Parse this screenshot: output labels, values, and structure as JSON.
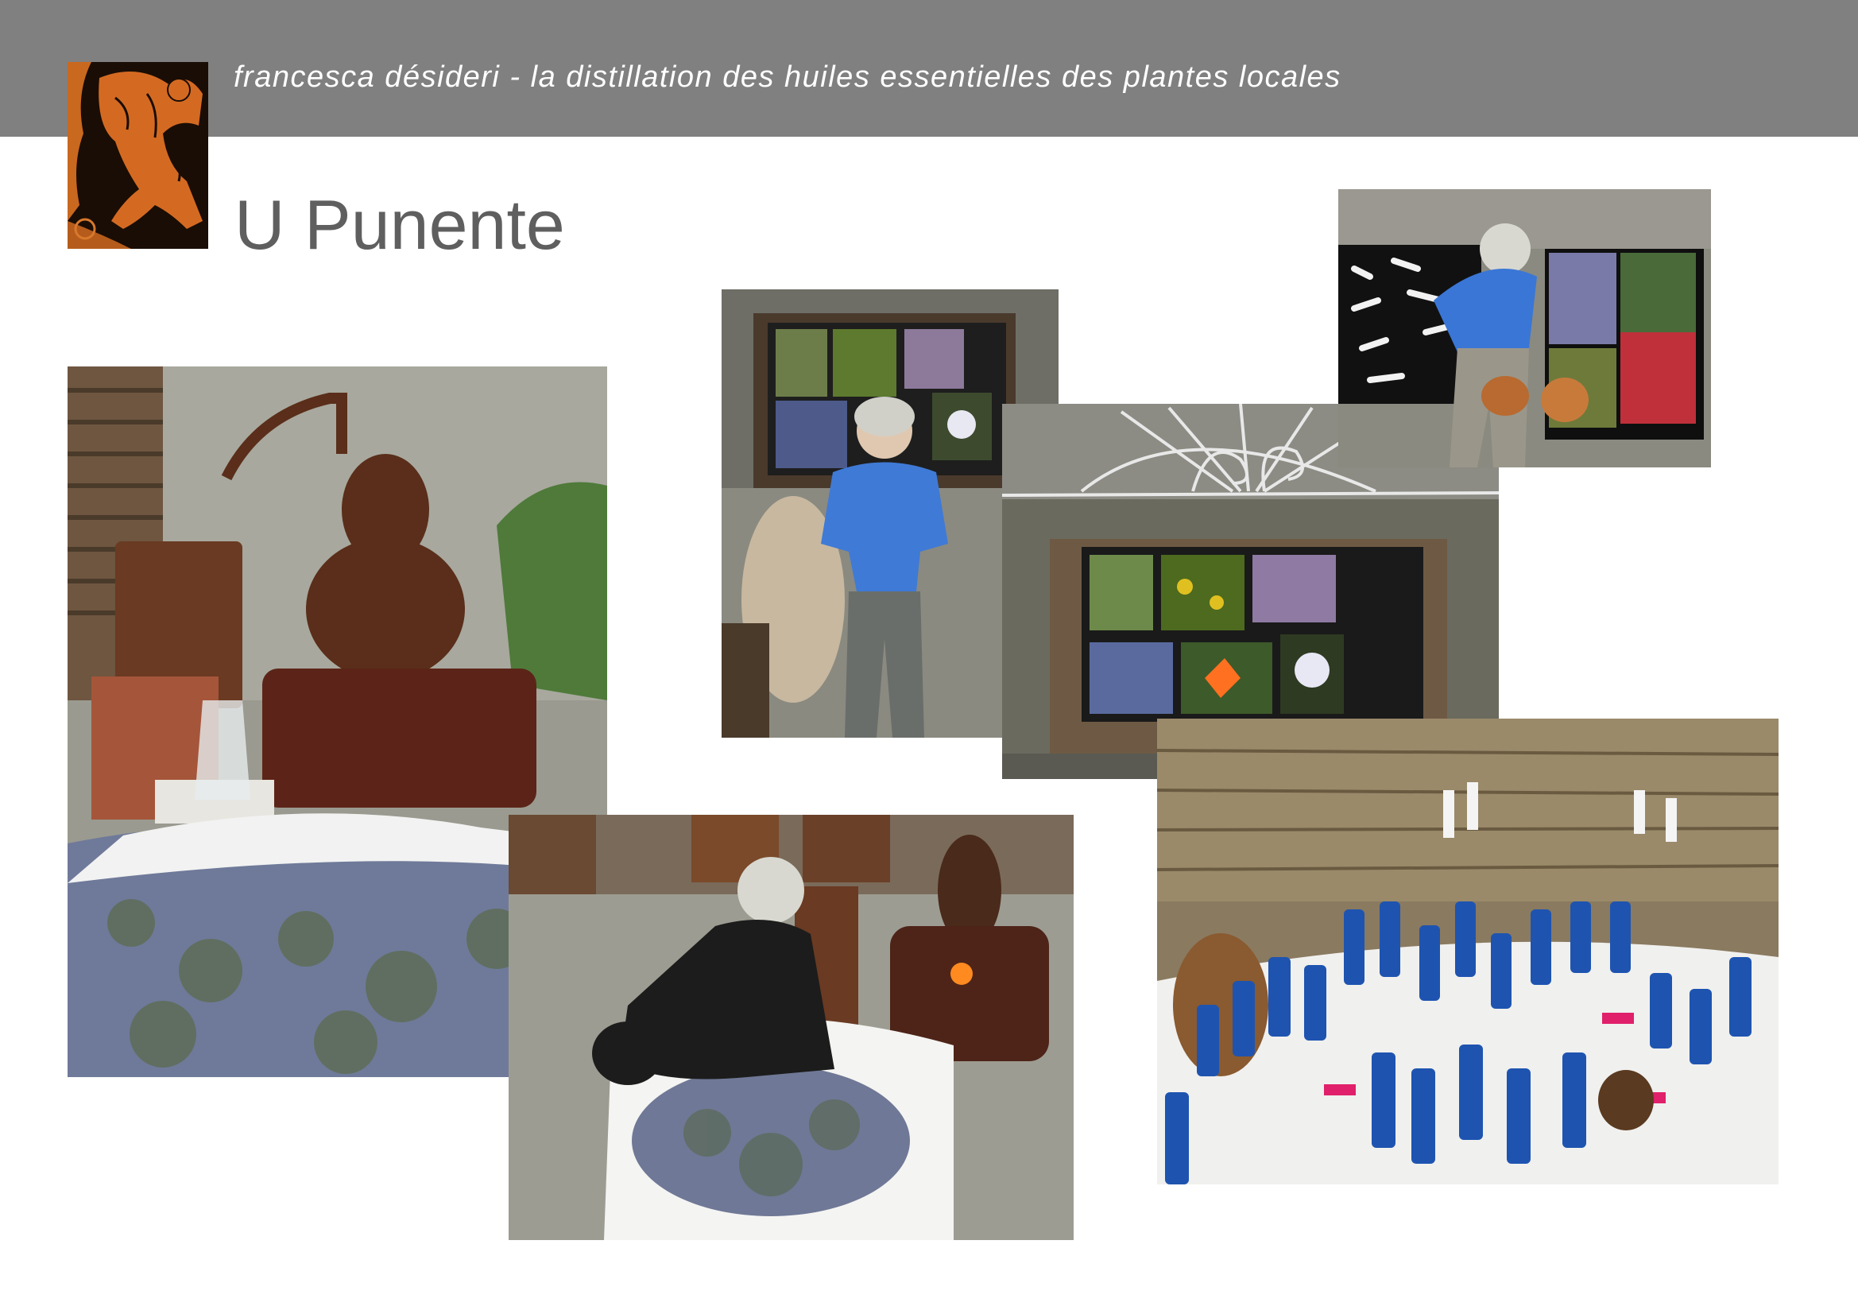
{
  "header": {
    "subtitle": "francesca désideri - la distillation des huiles essentielles des plantes locales"
  },
  "page": {
    "title": "U Punente"
  },
  "colors": {
    "header_band": "#808080",
    "title_text": "#5f5f5f",
    "subtitle_text": "#ffffff",
    "logo_terracotta": "#d46a22"
  },
  "photos": [
    {
      "name": "photo-copper-still-rosemary",
      "icon": "copper-alembic-still"
    },
    {
      "name": "photo-woman-blue-shirt-panel",
      "icon": "woman-standing"
    },
    {
      "name": "photo-window-flower-panel",
      "icon": "flower-photo-board"
    },
    {
      "name": "photo-woman-copper-kettle",
      "icon": "woman-bending"
    },
    {
      "name": "photo-woman-sorting-rosemary",
      "icon": "woman-kneeling"
    },
    {
      "name": "photo-essential-oil-bottles",
      "icon": "blue-bottles-table"
    }
  ]
}
